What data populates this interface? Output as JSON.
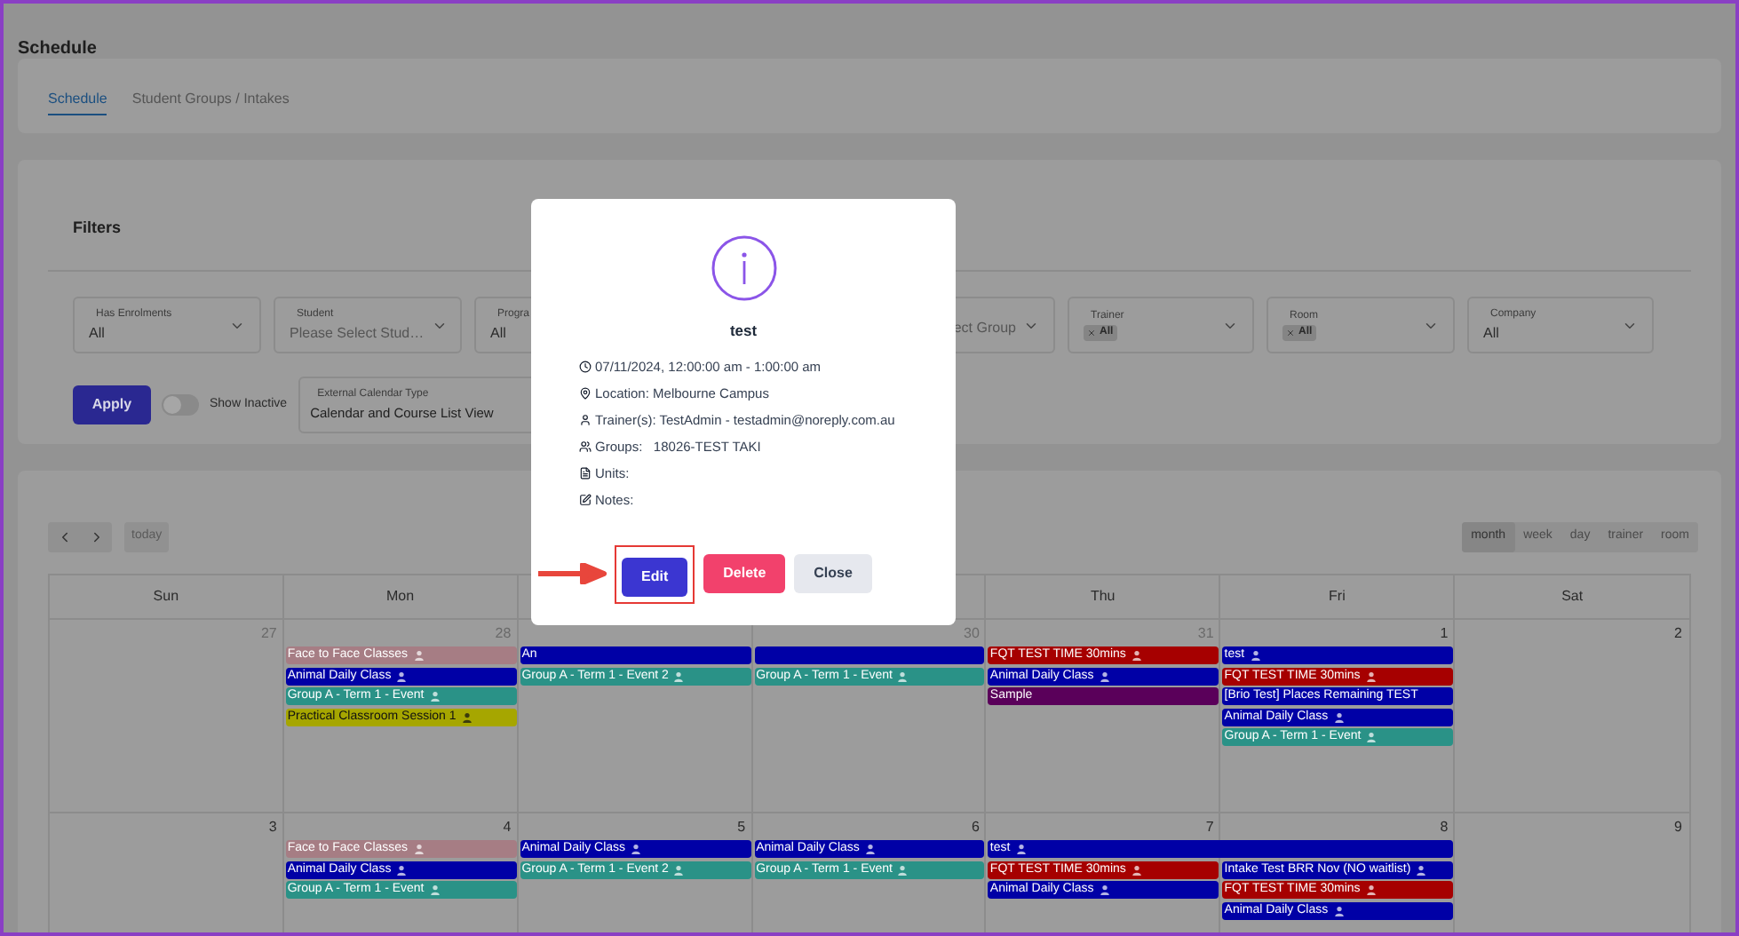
{
  "page_title": "Schedule",
  "tabs": [
    {
      "label": "Schedule",
      "selected": true
    },
    {
      "label": "Student Groups / Intakes",
      "selected": false
    }
  ],
  "filters": {
    "title": "Filters",
    "fields": [
      {
        "kind": "value",
        "label": "Has Enrolments",
        "value": "All"
      },
      {
        "kind": "placeholder",
        "label": "Student",
        "placeholder": "Please Select Stud…"
      },
      {
        "kind": "value",
        "label": "Progra",
        "value": "All"
      },
      {
        "kind": "placeholder",
        "placeholder": "ect Group"
      },
      {
        "kind": "chips",
        "label": "Trainer",
        "chips": [
          "All"
        ]
      },
      {
        "kind": "chips",
        "label": "Room",
        "chips": [
          "All"
        ]
      },
      {
        "kind": "value",
        "label": "Company",
        "value": "All"
      }
    ],
    "apply_button": "Apply",
    "show_inactive": {
      "label": "Show Inactive",
      "on": false
    },
    "calendar_type": {
      "label": "External Calendar Type",
      "value": "Calendar and Course List View"
    }
  },
  "calendar": {
    "today_button": "today",
    "views": [
      {
        "label": "month",
        "selected": true
      },
      {
        "label": "week",
        "selected": false
      },
      {
        "label": "day",
        "selected": false
      },
      {
        "label": "trainer",
        "selected": false
      },
      {
        "label": "room",
        "selected": false
      }
    ],
    "day_headers": [
      {
        "label": "Sun"
      },
      {
        "label": "Mon"
      },
      {
        "covered": true
      },
      {
        "covered": true
      },
      {
        "label": "Thu"
      },
      {
        "label": "Fri"
      },
      {
        "label": "Sat"
      }
    ],
    "weeks": [
      {
        "days": [
          {
            "date": "27",
            "outside_month": true
          },
          {
            "date": "28",
            "outside_month": true,
            "events": [
              {
                "title": "Face to Face Classes",
                "color": "#a67d84",
                "trainer_icon": true
              },
              {
                "title": "Animal Daily Class",
                "color": "#0000a6",
                "trainer_icon": true
              },
              {
                "title": "Group A - Term 1 - Event",
                "color": "#2a9287",
                "trainer_icon": true
              },
              {
                "title": "Practical Classroom Session 1",
                "color": "#a6a600",
                "trainer_icon": true
              }
            ]
          },
          {
            "events": [
              {
                "title": "An",
                "color": "#0000a6",
                "trainer_icon": false
              },
              {
                "title": "Group A - Term 1 - Event 2",
                "color": "#2a9287",
                "trainer_icon": true
              }
            ]
          },
          {
            "date": "30",
            "outside_month": true,
            "events": [
              {
                "color": "#0000a6",
                "trainer_icon": false
              },
              {
                "title": "Group A - Term 1 - Event",
                "color": "#2a9287",
                "trainer_icon": true
              }
            ]
          },
          {
            "date": "31",
            "outside_month": true,
            "events": [
              {
                "title": "FQT TEST TIME 30mins",
                "color": "#a60000",
                "trainer_icon": true
              },
              {
                "title": "Animal Daily Class",
                "color": "#0000a6",
                "trainer_icon": true
              },
              {
                "title": "Sample",
                "color": "#5a005a",
                "trainer_icon": false
              }
            ]
          },
          {
            "date": "1",
            "outside_month": false,
            "events": [
              {
                "title": "test",
                "color": "#0000a6",
                "trainer_icon": true
              },
              {
                "title": "FQT TEST TIME 30mins",
                "color": "#a60000",
                "trainer_icon": true
              },
              {
                "title": "[Brio Test] Places Remaining TEST",
                "color": "#0000a6",
                "trainer_icon": false
              },
              {
                "title": "Animal Daily Class",
                "color": "#0000a6",
                "trainer_icon": true
              },
              {
                "title": "Group A - Term 1 - Event",
                "color": "#2a9287",
                "trainer_icon": true
              }
            ]
          },
          {
            "date": "2",
            "outside_month": false
          }
        ]
      },
      {
        "days": [
          {
            "date": "3",
            "outside_month": false
          },
          {
            "date": "4",
            "outside_month": false,
            "events": [
              {
                "title": "Face to Face Classes",
                "color": "#a67d84",
                "trainer_icon": true
              },
              {
                "title": "Animal Daily Class",
                "color": "#0000a6",
                "trainer_icon": true
              },
              {
                "title": "Group A - Term 1 - Event",
                "color": "#2a9287",
                "trainer_icon": true
              }
            ]
          },
          {
            "date": "5",
            "outside_month": false,
            "events": [
              {
                "title": "Animal Daily Class",
                "color": "#0000a6",
                "trainer_icon": true
              },
              {
                "title": "Group A - Term 1 - Event 2",
                "color": "#2a9287",
                "trainer_icon": true
              }
            ]
          },
          {
            "date": "6",
            "outside_month": false,
            "events": [
              {
                "title": "Animal Daily Class",
                "color": "#0000a6",
                "trainer_icon": true
              },
              {
                "title": "Group A - Term 1 - Event",
                "color": "#2a9287",
                "trainer_icon": true
              }
            ]
          },
          {
            "date": "7",
            "outside_month": false,
            "events": [
              {
                "title": "test",
                "color": "#0000a6",
                "trainer_icon": true,
                "spans_next_day": true
              },
              {
                "title": "FQT TEST TIME 30mins",
                "color": "#a60000",
                "trainer_icon": true
              },
              {
                "title": "Animal Daily Class",
                "color": "#0000a6",
                "trainer_icon": true
              }
            ]
          },
          {
            "date": "8",
            "outside_month": false,
            "events": [
              {
                "title": "Intake Test BRR Nov (NO waitlist)",
                "color": "#0000a6",
                "trainer_icon": true
              },
              {
                "title": "FQT TEST TIME 30mins",
                "color": "#a60000",
                "trainer_icon": true
              },
              {
                "title": "Animal Daily Class",
                "color": "#0000a6",
                "trainer_icon": true
              }
            ]
          },
          {
            "date": "9",
            "outside_month": false
          }
        ]
      }
    ]
  },
  "modal": {
    "title": "test",
    "details": [
      {
        "kind": "time",
        "text": "07/11/2024, 12:00:00 am - 1:00:00 am"
      },
      {
        "kind": "location",
        "text": "Location: Melbourne Campus"
      },
      {
        "kind": "trainer",
        "text": "Trainer(s): TestAdmin - testadmin@noreply.com.au"
      },
      {
        "kind": "groups",
        "text": "Groups:   18026-TEST TAKI"
      },
      {
        "kind": "units",
        "text": "Units:"
      },
      {
        "kind": "notes",
        "text": "Notes:"
      }
    ],
    "buttons": [
      {
        "kind": "primary",
        "label": "Edit",
        "highlighted": true
      },
      {
        "kind": "danger",
        "label": "Delete",
        "highlighted": false
      },
      {
        "kind": "secondary",
        "label": "Close",
        "highlighted": false
      }
    ]
  }
}
